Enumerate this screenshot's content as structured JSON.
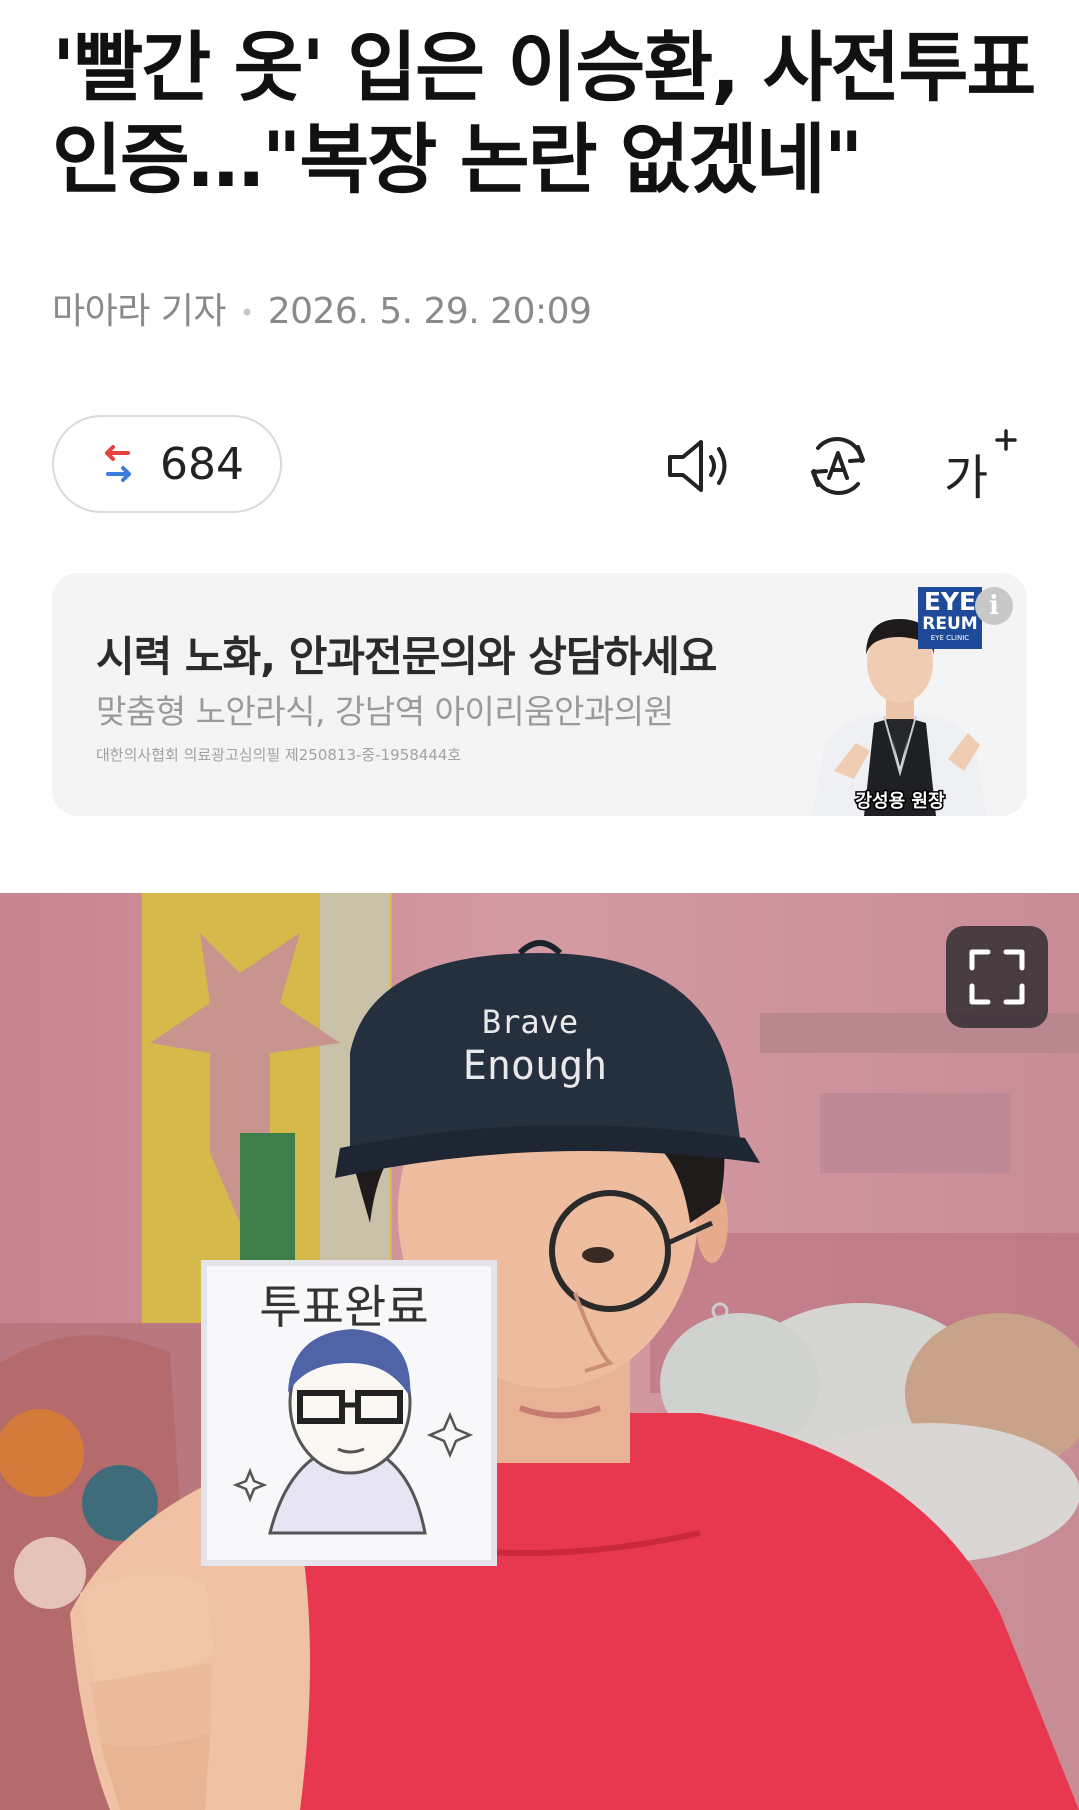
{
  "article": {
    "headline": "'빨간 옷' 입은 이승환, 사전투표 인증…\"복장 논란 없겠네\"",
    "reporter": "마아라 기자",
    "datetime": "2026. 5. 29. 20:09"
  },
  "toolbar": {
    "share_count": "684",
    "share_icon": "share-arrows-icon",
    "tts_icon": "speaker-icon",
    "translate_icon": "translate-a-icon",
    "font_size_label": "가"
  },
  "ad": {
    "title": "시력 노화, 안과전문의와 상담하세요",
    "subtitle": "맞춤형 노안라식, 강남역 아이리움안과의원",
    "note": "대한의사협회 의료광고심의필 제250813-중-1958444호",
    "logo_line1": "EYE",
    "logo_line2": "REUM",
    "logo_line3": "EYE CLINIC",
    "person_caption": "강성용 원장",
    "info_label": "i"
  },
  "photo": {
    "cap_text_line1": "Brave",
    "cap_text_line2": "Enough",
    "card_text": "투표완료",
    "expand_icon": "fullscreen-icon"
  },
  "colors": {
    "share_red": "#e8423e",
    "share_blue": "#3b7ddd",
    "shirt": "#e8384f",
    "cap": "#25303f",
    "logo_blue": "#1f4a9a"
  }
}
